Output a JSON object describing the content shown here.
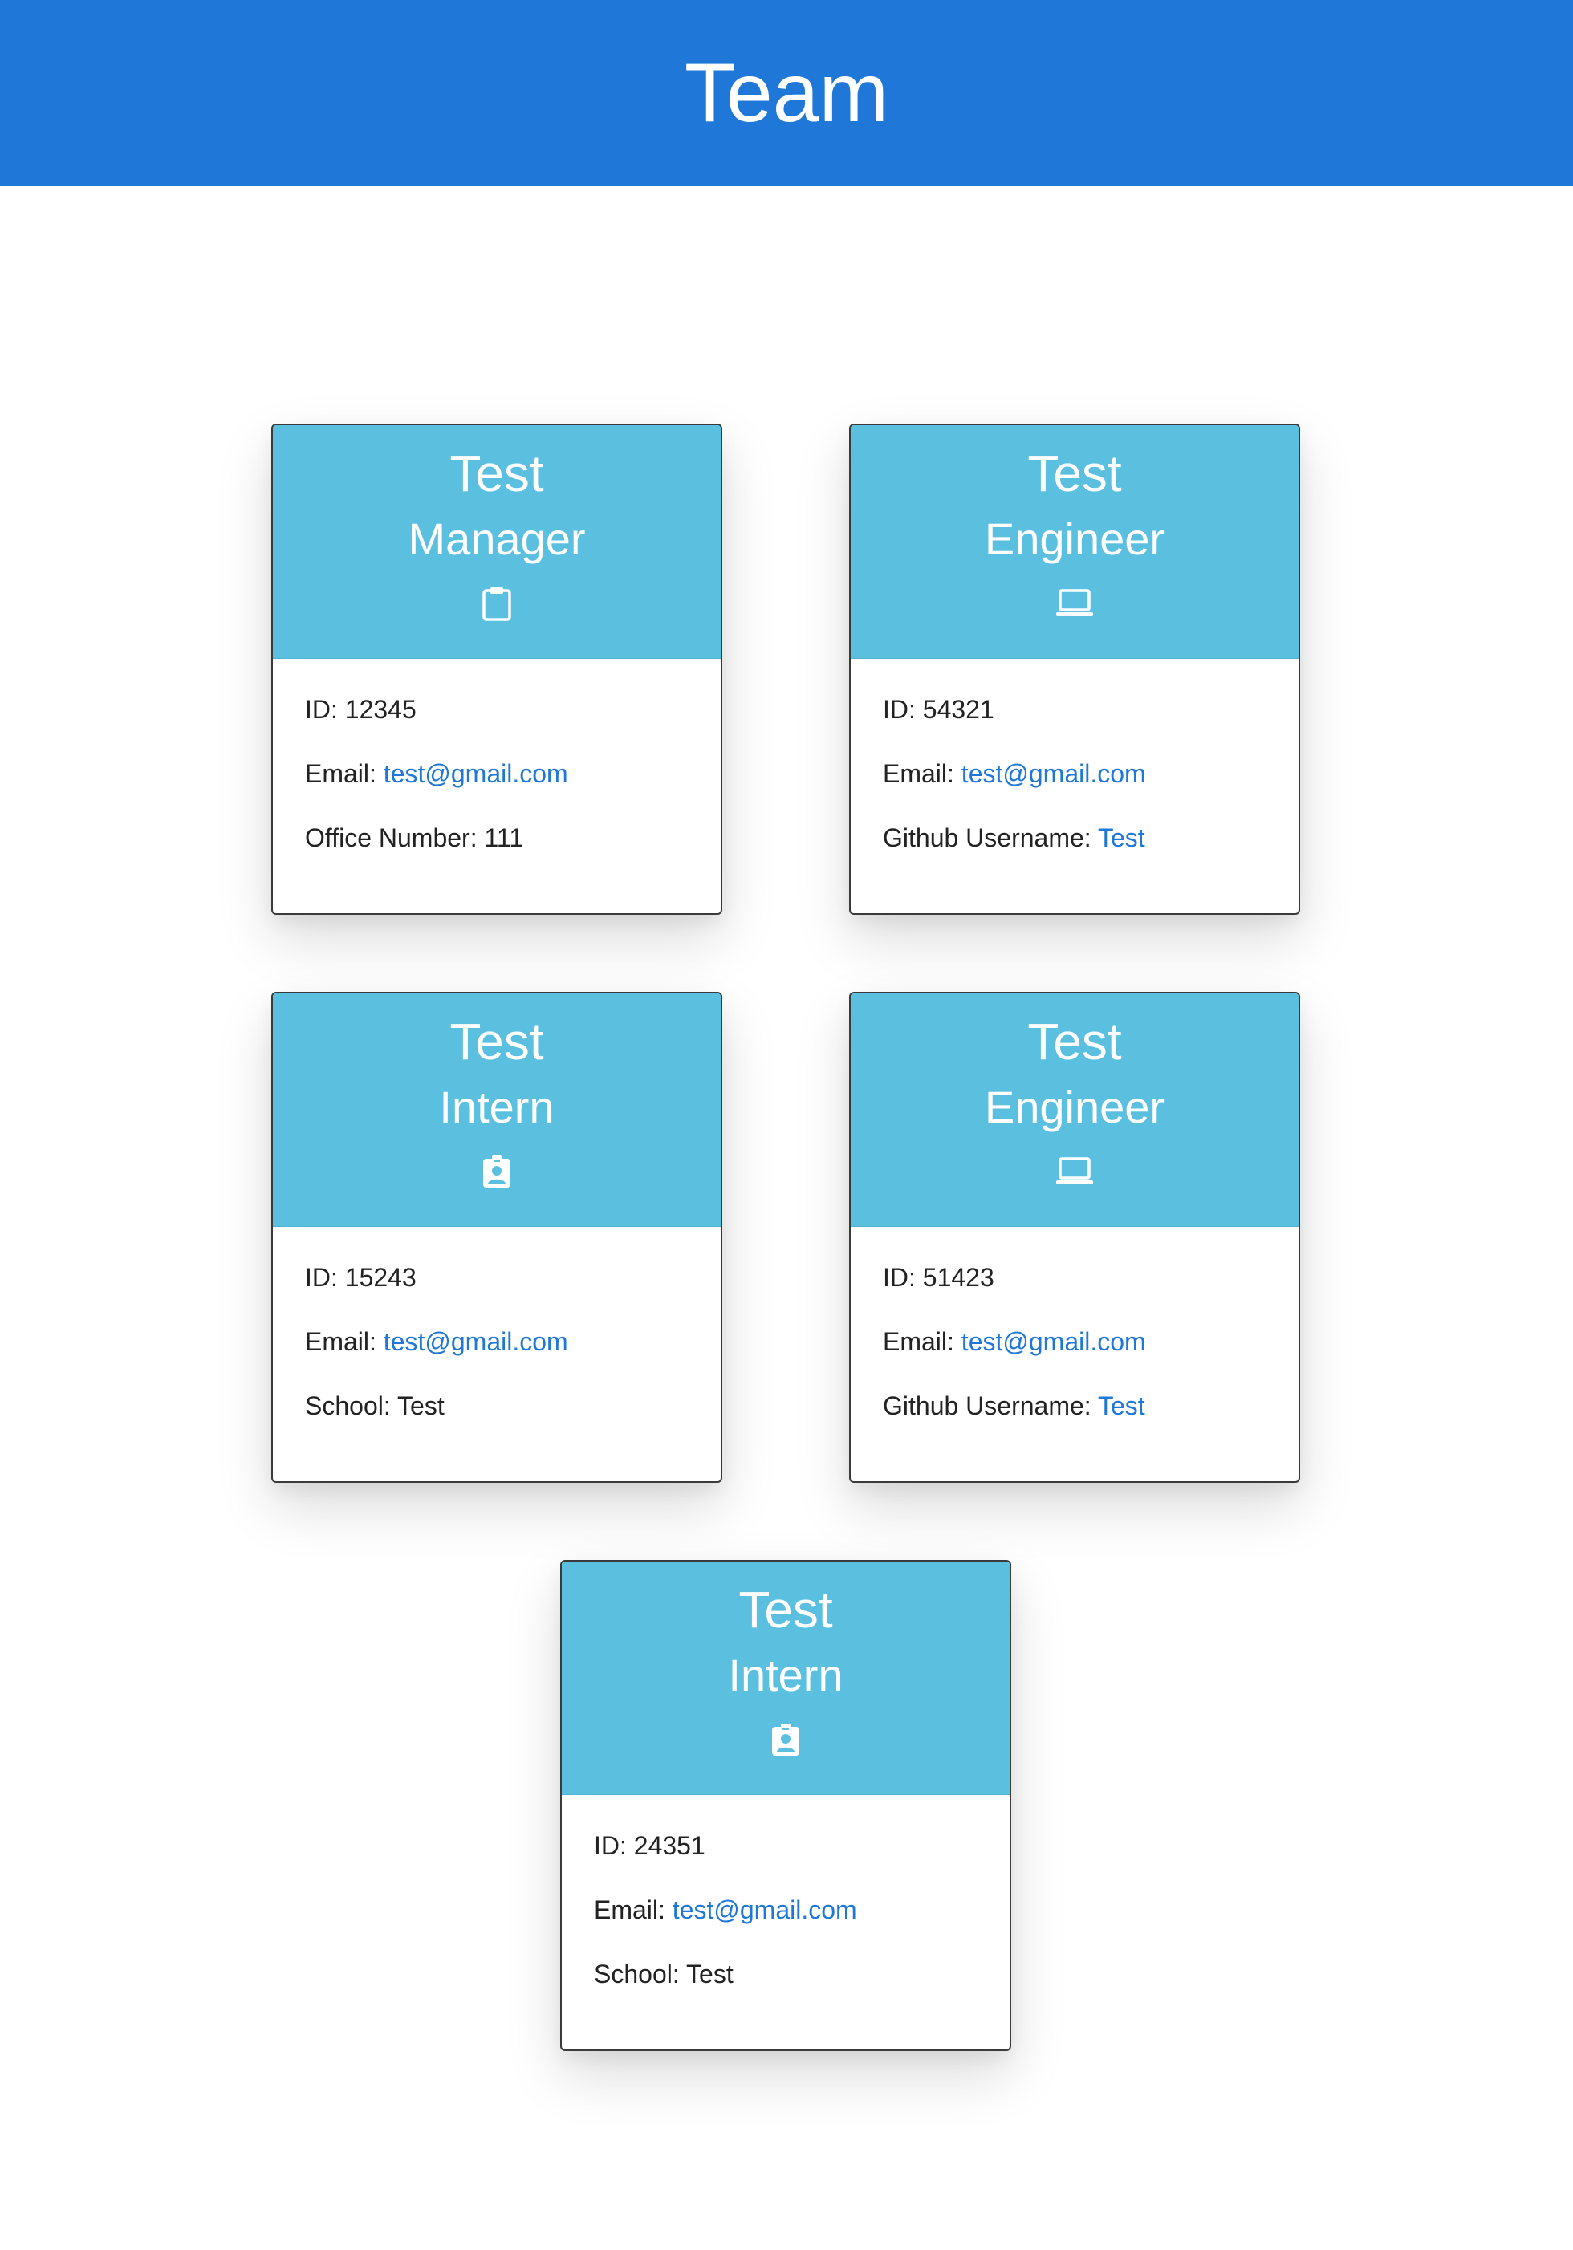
{
  "header": {
    "title": "Team"
  },
  "labels": {
    "id": "ID:",
    "email": "Email:",
    "office": "Office Number:",
    "github": "Github Username:",
    "school": "School:"
  },
  "cards": [
    {
      "name": "Test",
      "role": "Manager",
      "icon": "clipboard-icon",
      "id": "12345",
      "email": "test@gmail.com",
      "extra_label": "Office Number:",
      "extra_value": "111"
    },
    {
      "name": "Test",
      "role": "Engineer",
      "icon": "laptop-icon",
      "id": "54321",
      "email": "test@gmail.com",
      "extra_label": "Github Username:",
      "extra_value": "Test"
    },
    {
      "name": "Test",
      "role": "Intern",
      "icon": "id-badge-icon",
      "id": "15243",
      "email": "test@gmail.com",
      "extra_label": "School:",
      "extra_value": "Test"
    },
    {
      "name": "Test",
      "role": "Engineer",
      "icon": "laptop-icon",
      "id": "51423",
      "email": "test@gmail.com",
      "extra_label": "Github Username:",
      "extra_value": "Test"
    },
    {
      "name": "Test",
      "role": "Intern",
      "icon": "id-badge-icon",
      "id": "24351",
      "email": "test@gmail.com",
      "extra_label": "School:",
      "extra_value": "Test"
    }
  ],
  "colors": {
    "header_bg": "#1f78d7",
    "card_head_bg": "#5bc0df",
    "link": "#1f78d7"
  }
}
